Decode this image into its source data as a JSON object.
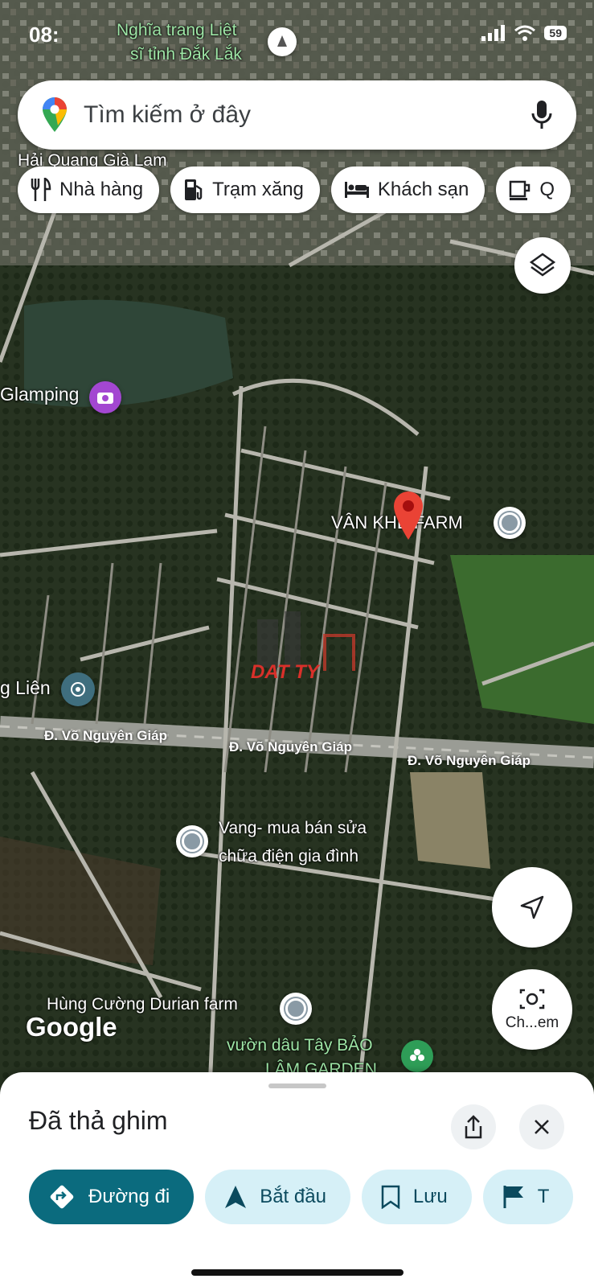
{
  "status_bar": {
    "time": "08:",
    "battery": "59"
  },
  "search": {
    "placeholder": "Tìm kiếm ở đây"
  },
  "chips": [
    {
      "label": "Nhà hàng",
      "icon": "restaurant-icon"
    },
    {
      "label": "Trạm xăng",
      "icon": "gas-station-icon"
    },
    {
      "label": "Khách sạn",
      "icon": "hotel-icon"
    },
    {
      "label": "Q",
      "icon": "coffee-icon"
    }
  ],
  "map": {
    "labels": [
      {
        "text": "Nghĩa trang Liệt"
      },
      {
        "text": "sĩ tỉnh Đắk Lắk"
      },
      {
        "text": "Hải Quang Già Lam"
      },
      {
        "text": "Glamping"
      },
      {
        "text": "VÂN KHÊ FARM"
      },
      {
        "text": "g Liên"
      },
      {
        "text": "Vang- mua bán sửa"
      },
      {
        "text": "chữa điện gia đình"
      },
      {
        "text": "Hùng Cường Durian farm"
      },
      {
        "text": "vườn dâu Tây BẢO"
      },
      {
        "text": "LÂM GARDEN"
      }
    ],
    "roads": [
      "Đ. Võ Nguyên Giáp",
      "Đ. Võ Nguyên Giáp",
      "Đ. Võ Nguyên Giáp"
    ],
    "watermark": "DAT TY",
    "google_logo": "Google",
    "lens_label": "Ch...em"
  },
  "sheet": {
    "title": "Đã thả ghim",
    "actions": [
      {
        "label": "Đường đi",
        "icon": "directions-icon"
      },
      {
        "label": "Bắt đầu",
        "icon": "navigation-arrow-icon"
      },
      {
        "label": "Lưu",
        "icon": "bookmark-icon"
      },
      {
        "label": "T",
        "icon": "flag-icon"
      }
    ]
  },
  "colors": {
    "accent": "#0b6b7e",
    "pin": "#ea4335",
    "chip_tint": "#d6f0f7"
  }
}
